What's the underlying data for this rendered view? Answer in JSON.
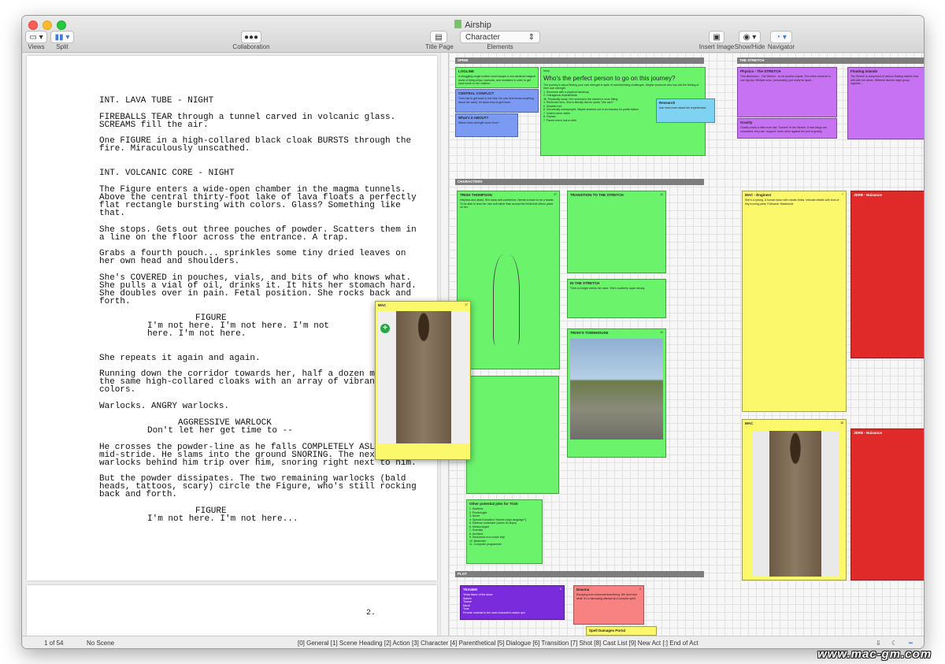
{
  "window": {
    "title": "Airship"
  },
  "toolbar": {
    "views": "Views",
    "split": "Split",
    "collaboration": "Collaboration",
    "title_page": "Title Page",
    "element_select": "Character",
    "elements": "Elements",
    "insert_image": "Insert Image",
    "show_hide": "Show/Hide",
    "navigator": "Navigator"
  },
  "script": {
    "lines": [
      "INT. LAVA TUBE - NIGHT",
      "FIREBALLS TEAR through a tunnel carved in volcanic glass.",
      "SCREAMS fill the air.",
      "One FIGURE in a high-collared black cloak BURSTS through the",
      "fire. Miraculously unscathed.",
      "INT. VOLCANIC CORE - NIGHT",
      "The Figure enters a wide-open chamber in the magma tunnels.",
      "Above the central thirty-foot lake of lava floats a perfectly",
      "flat rectangle bursting with colors. Glass? Something like",
      "that.",
      "She stops. Gets out three pouches of powder. Scatters them in",
      "a line on the floor across the entrance. A trap.",
      "Grabs a fourth pouch... sprinkles some tiny dried leaves on",
      "her own head and shoulders.",
      "She's COVERED in pouches, vials, and bits of who knows what.",
      "She pulls a vial of oil, drinks it. It hits her stomach hard.",
      "She doubles over in pain. Fetal position. She rocks back and",
      "forth.",
      "FIGURE",
      "I'm not here. I'm not here. I'm not",
      "here. I'm not here.",
      "She repeats it again and again.",
      "Running down the corridor towards her, half a dozen men in",
      "the same high-collared cloaks with an array of vibrant",
      "colors.",
      "Warlocks. ANGRY warlocks.",
      "AGGRESSIVE WARLOCK",
      "Don't let her get time to --",
      "He crosses the powder-line as he falls COMPLETELY ASLEEP in",
      "mid-stride. He slams into the ground SNORING. The next few",
      "warlocks behind him trip over him, snoring right next to him.",
      "But the powder dissipates. The two remaining warlocks (bald",
      "heads, tattoos, scary) circle the Figure, who's still rocking",
      "back and forth.",
      "FIGURE",
      "I'm not here. I'm not here..."
    ],
    "page_number": "2."
  },
  "board": {
    "sections": {
      "spine": "SPINE",
      "characters": "CHARACTERS",
      "plot": "PLOT",
      "stretch": "THE STRETCH"
    },
    "cards": {
      "logline": {
        "title": "LOGLINE",
        "body": "A struggling single mother must escape a non-sensical magical world of flying ships, warlocks, and monsters in order to get back home to her children."
      },
      "central_conflict": {
        "title": "CENTRAL CONFLICT",
        "body": "Trish has to get back to her kids. No one here knows anything about her world, let alone how to get home."
      },
      "whats_about": {
        "title": "What's it ABOUT?",
        "body": "Where does strength come from?"
      },
      "irony": {
        "label": "Irony",
        "title": "Who's the perfect person to go on this journey?",
        "body": "The journey is about finding your own strength in spite of overwhelming challenges. Maybe someone who has lost the feeling of their own strength.",
        "items": [
          "1. Someone with a physical handicap",
          "2. Outrageous impediments",
          "3b. Physically weak. Her reversal in the stretch is more fitting",
          "4. Reformed hero. She is literally told for years \"she can't\"",
          "5. Disabled vet",
          "6. Chronically unemployed. Maybe shamed out of an industry for public failure.",
          "7. Violent crime victim",
          "8. Orphan",
          "7. Parent who's lost a child"
        ]
      },
      "research": {
        "title": "Research",
        "body": "Ask mom more about her experiences."
      },
      "physics": {
        "title": "Physics - The STRETCH",
        "body": "This dimension - The Stretch - is not another planet. The entire universe is one big sky. Multiple suns, presumably, just really far apart."
      },
      "floating_islands": {
        "title": "Floating Islands",
        "body": "The Stretch is comprised of various floating islands that drift with the winds. Different islands might group together..."
      },
      "gravity": {
        "title": "Gravity",
        "body": "Gravity works a little more like \"Current\" in the Stretch. It has things are connected, they can \"support\" each other against the pull of gravity."
      },
      "trish": {
        "title": "TRISH THOMPSON",
        "page": "17",
        "body": "Helpless and afraid. She lacks self-confidence. Needs to learn to be a leader. To be able to lead her own self rather than accept the limits that others place on her."
      },
      "transition": {
        "title": "TRANSITION TO THE STRETCH",
        "page": "11"
      },
      "in_stretch": {
        "title": "IN THE STRETCH",
        "body": "Trish no longer needs her cane. She's suddenly super strong."
      },
      "townhouse": {
        "title": "TRISH'S TOWNHOUSE",
        "page": "12"
      },
      "mac_engineer": {
        "title": "MAC - Engineer",
        "page": "7",
        "body": "She's a cyborg. A human torso with robotic limbs. Intricate details with tons of tiny moving parts. Fullname: Mackenzie"
      },
      "jerb": {
        "title": "JERB - Nuisance",
        "page": "9"
      },
      "mac_float": {
        "title": "MAC",
        "page": "17"
      },
      "mac_card": {
        "title": "MAC",
        "page": "18"
      },
      "jerb2": {
        "title": "JERB - Nuisance"
      },
      "other_jobs": {
        "title": "Other potential jobs for Trish",
        "items": [
          "1. Waitress",
          "2. Proctologist",
          "3. Nurse",
          "4. Special Education Teacher (sign language?)",
          "5. Defense contractor (works on ships)",
          "6. Meteorologist",
          "7. Scientist",
          "8. Architect",
          "9. Deckhand on a cruise ship",
          "10. Bartender",
          "11. Computer programmer"
        ]
      },
      "teaser": {
        "title": "TEASER",
        "page": "1",
        "items": [
          "Texas flavor of the show",
          "Stakes",
          "Theme",
          "Mood",
          "Tone",
          "Provide contrast to the main character's status quo"
        ]
      },
      "deanna": {
        "title": "Deanna",
        "page": "2",
        "body": "Escaping from someone/something. We don't see what. It's a harrowing attempt at a complex spell."
      },
      "spell_portal": {
        "title": "Spell Damages Portal"
      }
    }
  },
  "statusbar": {
    "page_count": "1 of 54",
    "scene": "No Scene",
    "shortcuts": "[0] General  [1] Scene Heading  [2] Action  [3] Character  [4] Parenthetical  [5] Dialogue  [6] Transition  [7] Shot  [8] Cast List  [9] New Act  [:] End of Act"
  },
  "watermark": "www.mac-gm.com",
  "colors": {
    "green": "#6cf36c",
    "yellow": "#fbf86b",
    "purple": "#c672f3",
    "blue": "#7b9af3",
    "red": "#e02a2a",
    "light_blue": "#7ed3f2",
    "violet": "#7a2bdb",
    "salmon": "#f88181"
  }
}
